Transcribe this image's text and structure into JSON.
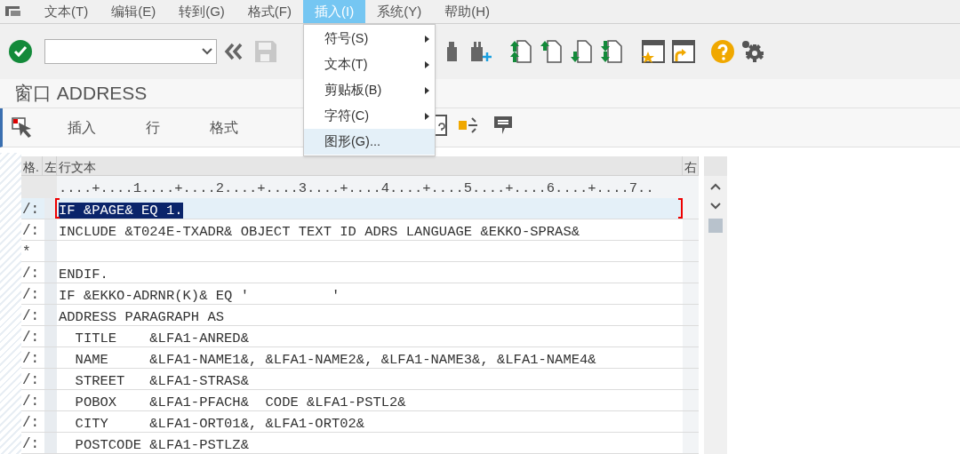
{
  "menu_bar": [
    {
      "label": "文本(T)",
      "selected": false
    },
    {
      "label": "编辑(E)",
      "selected": false
    },
    {
      "label": "转到(G)",
      "selected": false
    },
    {
      "label": "格式(F)",
      "selected": false
    },
    {
      "label": "插入(I)",
      "selected": true
    },
    {
      "label": "系统(Y)",
      "selected": false
    },
    {
      "label": "帮助(H)",
      "selected": false
    }
  ],
  "dropdown_menu": [
    {
      "label": "符号(S)",
      "has_submenu": true,
      "hovered": false
    },
    {
      "label": "文本(T)",
      "has_submenu": true,
      "hovered": false
    },
    {
      "label": "剪贴板(B)",
      "has_submenu": true,
      "hovered": false
    },
    {
      "label": "字符(C)",
      "has_submenu": true,
      "hovered": false
    },
    {
      "label": "图形(G)...",
      "has_submenu": false,
      "hovered": true
    }
  ],
  "title": "窗口 ADDRESS",
  "app_toolbar": [
    "插入",
    "行",
    "格式"
  ],
  "table": {
    "columns": [
      "格.",
      "左",
      "行文本",
      "右"
    ],
    "ruler": "....+....1....+....2....+....3....+....4....+....5....+....6....+....7..",
    "rows": [
      {
        "format": "/:",
        "text": "IF &PAGE& EQ 1.",
        "selected": true
      },
      {
        "format": "/:",
        "text": "INCLUDE &T024E-TXADR& OBJECT TEXT ID ADRS LANGUAGE &EKKO-SPRAS&",
        "selected": false
      },
      {
        "format": "*",
        "text": "",
        "selected": false
      },
      {
        "format": "/:",
        "text": "ENDIF.",
        "selected": false
      },
      {
        "format": "/:",
        "text": "IF &EKKO-ADRNR(K)& EQ '          '",
        "selected": false
      },
      {
        "format": "/:",
        "text": "ADDRESS PARAGRAPH AS",
        "selected": false
      },
      {
        "format": "/:",
        "text": "  TITLE    &LFA1-ANRED&",
        "selected": false
      },
      {
        "format": "/:",
        "text": "  NAME     &LFA1-NAME1&, &LFA1-NAME2&, &LFA1-NAME3&, &LFA1-NAME4&",
        "selected": false
      },
      {
        "format": "/:",
        "text": "  STREET   &LFA1-STRAS&",
        "selected": false
      },
      {
        "format": "/:",
        "text": "  POBOX    &LFA1-PFACH&  CODE &LFA1-PSTL2&",
        "selected": false
      },
      {
        "format": "/:",
        "text": "  CITY     &LFA1-ORT01&, &LFA1-ORT02&",
        "selected": false
      },
      {
        "format": "/:",
        "text": "  POSTCODE &LFA1-PSTLZ&",
        "selected": false
      }
    ]
  }
}
